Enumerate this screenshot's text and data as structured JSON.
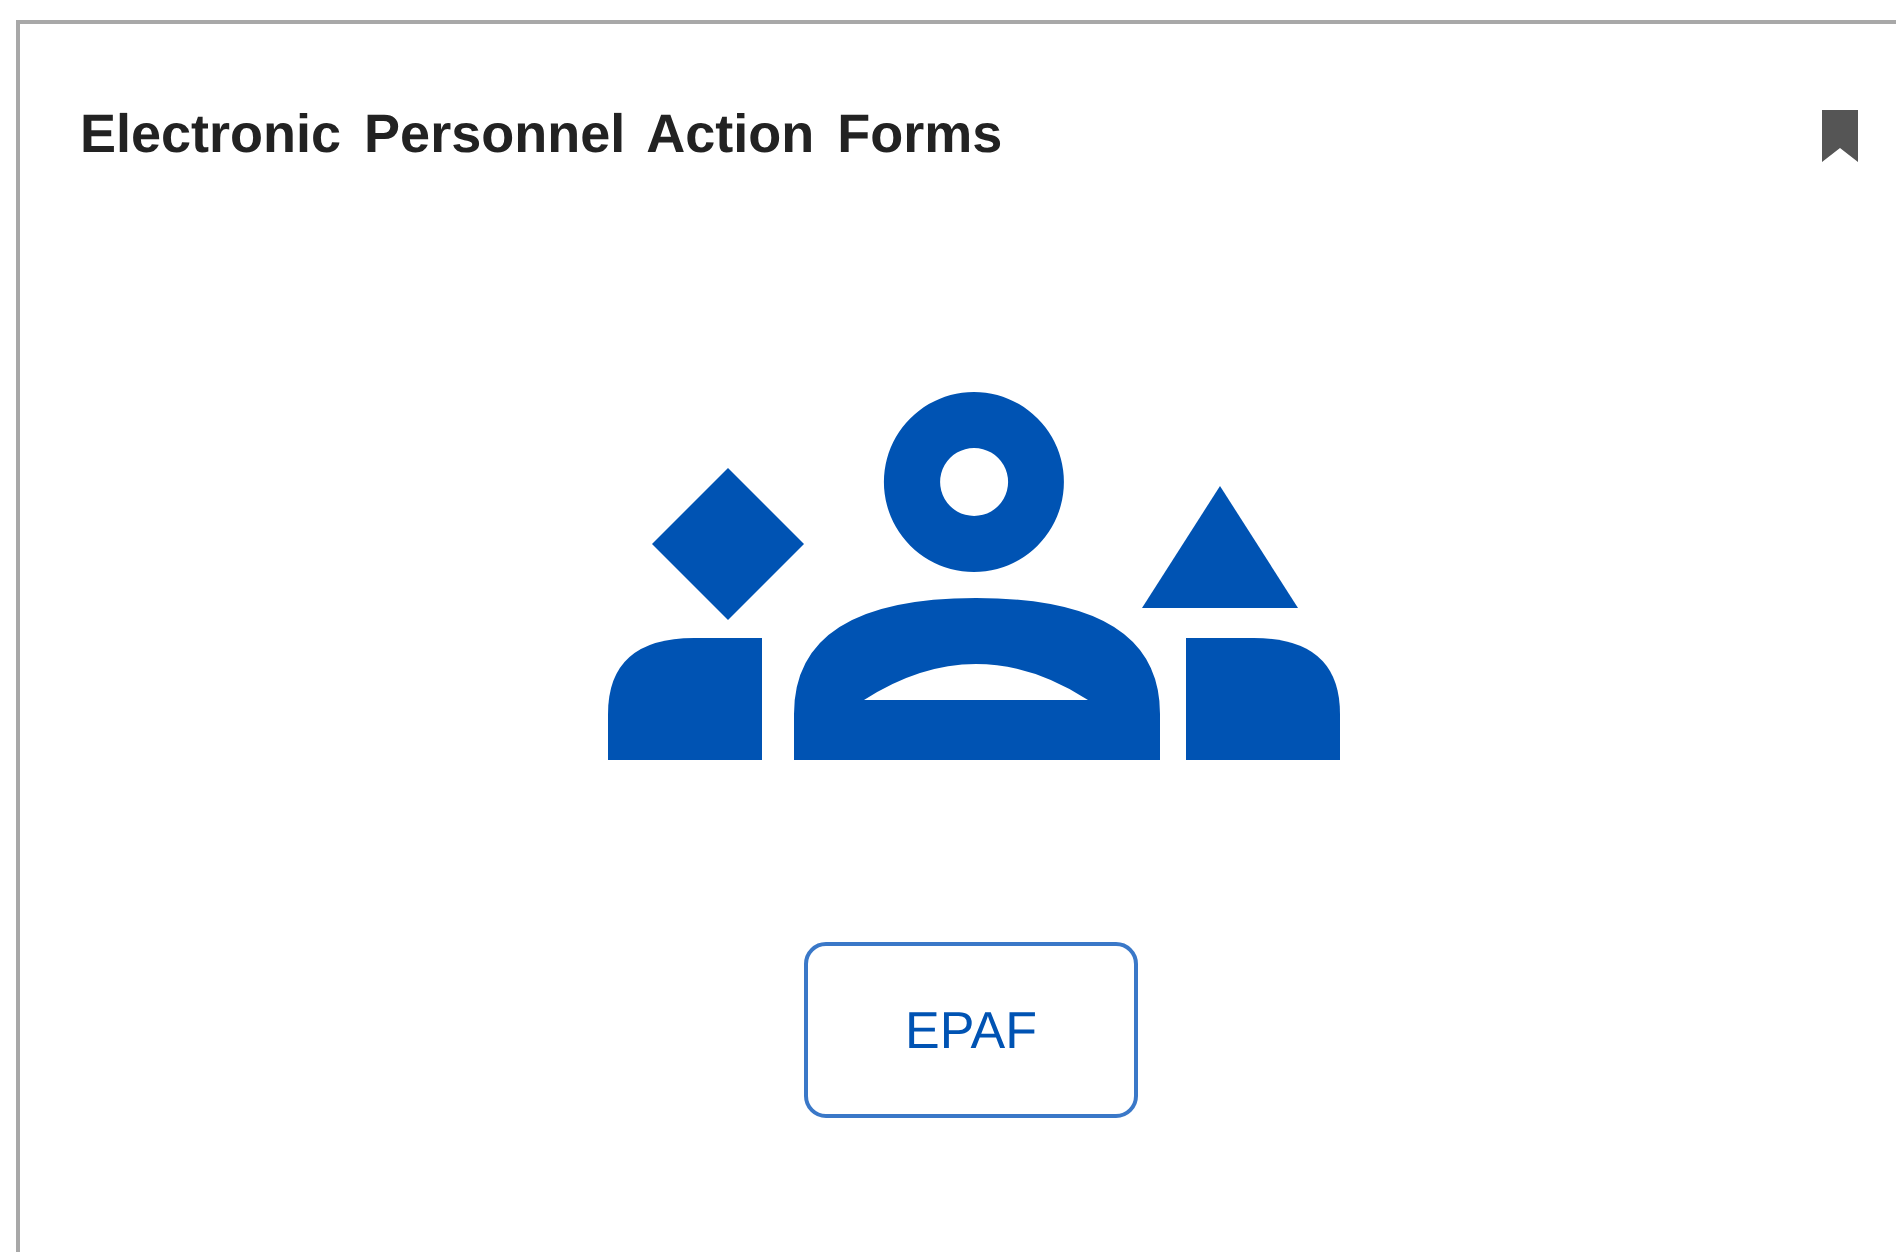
{
  "card": {
    "title": "Electronic Personnel Action Forms",
    "bookmarked": true,
    "button": "EPAF"
  }
}
